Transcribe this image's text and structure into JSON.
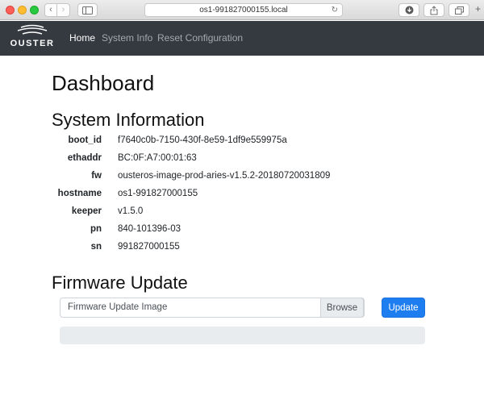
{
  "browser": {
    "url": "os1-991827000155.local",
    "back_glyph": "‹",
    "forward_glyph": "›",
    "reload_glyph": "↻",
    "add_glyph": "+"
  },
  "nav": {
    "brand": "OUSTER",
    "links": [
      {
        "label": "Home",
        "active": true
      },
      {
        "label": "System Info",
        "active": false
      },
      {
        "label": "Reset Configuration",
        "active": false
      }
    ]
  },
  "dashboard": {
    "title": "Dashboard",
    "system_info": {
      "heading": "System Information",
      "rows": [
        {
          "key": "boot_id",
          "value": "f7640c0b-7150-430f-8e59-1df9e559975a"
        },
        {
          "key": "ethaddr",
          "value": "BC:0F:A7:00:01:63"
        },
        {
          "key": "fw",
          "value": "ousteros-image-prod-aries-v1.5.2-20180720031809"
        },
        {
          "key": "hostname",
          "value": "os1-991827000155"
        },
        {
          "key": "keeper",
          "value": "v1.5.0"
        },
        {
          "key": "pn",
          "value": "840-101396-03"
        },
        {
          "key": "sn",
          "value": "991827000155"
        }
      ]
    },
    "firmware": {
      "heading": "Firmware Update",
      "file_placeholder": "Firmware Update Image",
      "browse_label": "Browse",
      "update_label": "Update",
      "progress_fraction": 0
    }
  },
  "colors": {
    "navbar_bg": "#343a40",
    "primary": "#1e7ef0",
    "progress_bg": "#e9ecef"
  }
}
